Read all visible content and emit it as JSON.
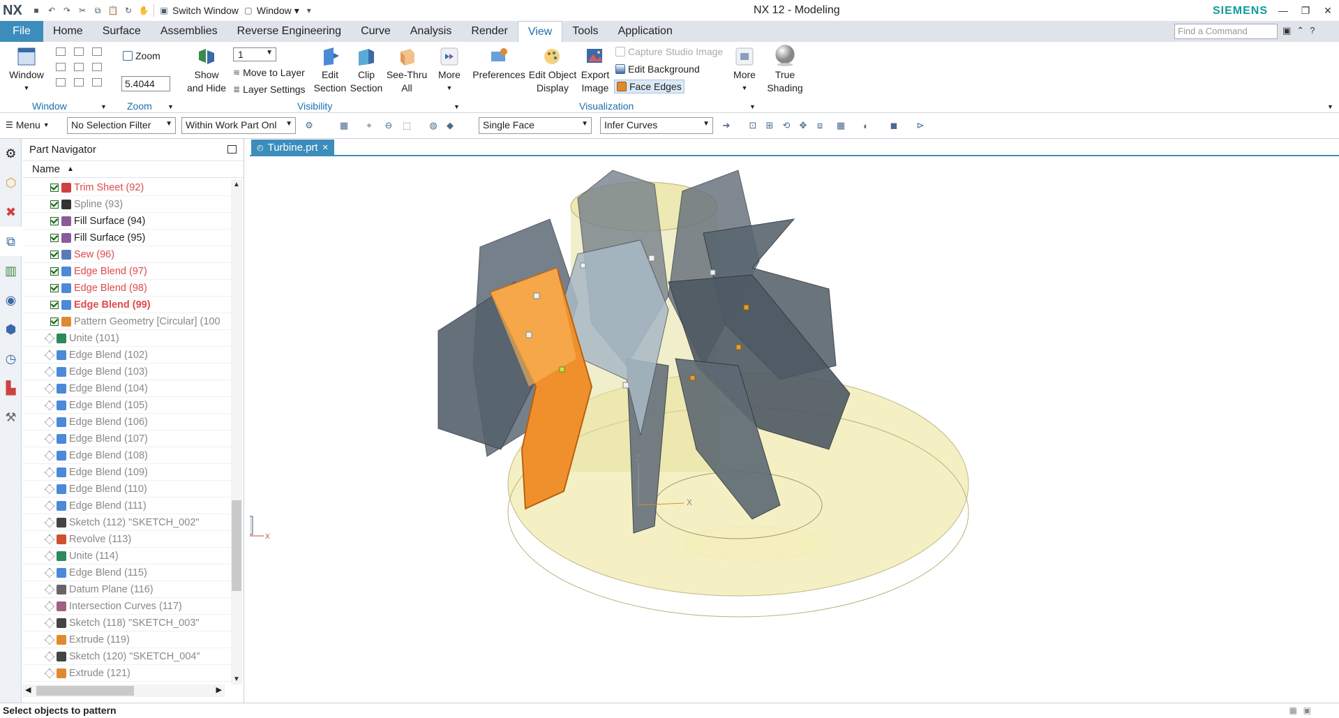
{
  "app": {
    "logo": "NX",
    "title": "NX 12 - Modeling",
    "brand": "SIEMENS"
  },
  "quick_access": {
    "switch_window": "Switch Window",
    "window": "Window"
  },
  "menu": {
    "file": "File",
    "tabs": [
      "Home",
      "Surface",
      "Assemblies",
      "Reverse Engineering",
      "Curve",
      "Analysis",
      "Render",
      "View",
      "Tools",
      "Application"
    ],
    "active_tab": "View",
    "find_placeholder": "Find a Command"
  },
  "ribbon": {
    "window_btn": "Window",
    "window_group": "Window",
    "zoom_btn": "Zoom",
    "zoom_value": "5.4044",
    "zoom_group": "Zoom",
    "layer_value": "1",
    "show_hide_1": "Show",
    "show_hide_2": "and Hide",
    "move_to_layer": "Move to Layer",
    "layer_settings": "Layer Settings",
    "edit_section_1": "Edit",
    "edit_section_2": "Section",
    "clip_section_1": "Clip",
    "clip_section_2": "Section",
    "see_thru_1": "See-Thru",
    "see_thru_2": "All",
    "more": "More",
    "visibility_group": "Visibility",
    "preferences": "Preferences",
    "edit_object_1": "Edit Object",
    "edit_object_2": "Display",
    "export_image_1": "Export",
    "export_image_2": "Image",
    "capture_studio": "Capture Studio Image",
    "edit_background": "Edit Background",
    "face_edges": "Face Edges",
    "visualization_group": "Visualization",
    "more2": "More",
    "true_shading_1": "True",
    "true_shading_2": "Shading"
  },
  "selection_bar": {
    "menu": "Menu",
    "filter": "No Selection Filter",
    "scope": "Within Work Part Onl",
    "face_rule": "Single Face",
    "curve_rule": "Infer Curves"
  },
  "navigator": {
    "title": "Part Navigator",
    "column": "Name",
    "items": [
      {
        "label": "Trim Sheet (92)",
        "style": "red",
        "checked": true,
        "icon": "trim-sheet-icon",
        "color": "#d04040"
      },
      {
        "label": "Spline (93)",
        "style": "gray",
        "checked": true,
        "icon": "spline-icon",
        "color": "#333333"
      },
      {
        "label": "Fill Surface (94)",
        "style": "dark",
        "checked": true,
        "icon": "fill-surface-icon",
        "color": "#8a5a9a"
      },
      {
        "label": "Fill Surface (95)",
        "style": "dark",
        "checked": true,
        "icon": "fill-surface-icon",
        "color": "#8a5a9a"
      },
      {
        "label": "Sew (96)",
        "style": "red",
        "checked": true,
        "icon": "sew-icon",
        "color": "#5a7ab8"
      },
      {
        "label": "Edge Blend (97)",
        "style": "red",
        "checked": true,
        "icon": "edge-blend-icon",
        "color": "#4a8ad8"
      },
      {
        "label": "Edge Blend (98)",
        "style": "red",
        "checked": true,
        "icon": "edge-blend-icon",
        "color": "#4a8ad8"
      },
      {
        "label": "Edge Blend (99)",
        "style": "red bold",
        "checked": true,
        "icon": "edge-blend-icon",
        "color": "#4a8ad8"
      },
      {
        "label": "Pattern Geometry [Circular] (100",
        "style": "gray",
        "checked": true,
        "icon": "pattern-geometry-icon",
        "color": "#e08a30"
      },
      {
        "label": "Unite (101)",
        "style": "gray",
        "checked": false,
        "icon": "unite-icon",
        "color": "#2a8a5a"
      },
      {
        "label": "Edge Blend (102)",
        "style": "gray",
        "checked": false,
        "icon": "edge-blend-icon",
        "color": "#4a8ad8"
      },
      {
        "label": "Edge Blend (103)",
        "style": "gray",
        "checked": false,
        "icon": "edge-blend-icon",
        "color": "#4a8ad8"
      },
      {
        "label": "Edge Blend (104)",
        "style": "gray",
        "checked": false,
        "icon": "edge-blend-icon",
        "color": "#4a8ad8"
      },
      {
        "label": "Edge Blend (105)",
        "style": "gray",
        "checked": false,
        "icon": "edge-blend-icon",
        "color": "#4a8ad8"
      },
      {
        "label": "Edge Blend (106)",
        "style": "gray",
        "checked": false,
        "icon": "edge-blend-icon",
        "color": "#4a8ad8"
      },
      {
        "label": "Edge Blend (107)",
        "style": "gray",
        "checked": false,
        "icon": "edge-blend-icon",
        "color": "#4a8ad8"
      },
      {
        "label": "Edge Blend (108)",
        "style": "gray",
        "checked": false,
        "icon": "edge-blend-icon",
        "color": "#4a8ad8"
      },
      {
        "label": "Edge Blend (109)",
        "style": "gray",
        "checked": false,
        "icon": "edge-blend-icon",
        "color": "#4a8ad8"
      },
      {
        "label": "Edge Blend (110)",
        "style": "gray",
        "checked": false,
        "icon": "edge-blend-icon",
        "color": "#4a8ad8"
      },
      {
        "label": "Edge Blend (111)",
        "style": "gray",
        "checked": false,
        "icon": "edge-blend-icon",
        "color": "#4a8ad8"
      },
      {
        "label": "Sketch (112) \"SKETCH_002\"",
        "style": "gray",
        "checked": false,
        "icon": "sketch-icon",
        "color": "#444444"
      },
      {
        "label": "Revolve (113)",
        "style": "gray",
        "checked": false,
        "icon": "revolve-icon",
        "color": "#d05030"
      },
      {
        "label": "Unite (114)",
        "style": "gray",
        "checked": false,
        "icon": "unite-icon",
        "color": "#2a8a5a"
      },
      {
        "label": "Edge Blend (115)",
        "style": "gray",
        "checked": false,
        "icon": "edge-blend-icon",
        "color": "#4a8ad8"
      },
      {
        "label": "Datum Plane (116)",
        "style": "gray",
        "checked": false,
        "icon": "datum-plane-icon",
        "color": "#666666"
      },
      {
        "label": "Intersection Curves (117)",
        "style": "gray",
        "checked": false,
        "icon": "intersection-curves-icon",
        "color": "#a06080"
      },
      {
        "label": "Sketch (118) \"SKETCH_003\"",
        "style": "gray",
        "checked": false,
        "icon": "sketch-icon",
        "color": "#444444"
      },
      {
        "label": "Extrude (119)",
        "style": "gray",
        "checked": false,
        "icon": "extrude-icon",
        "color": "#e08a30"
      },
      {
        "label": "Sketch (120) \"SKETCH_004\"",
        "style": "gray",
        "checked": false,
        "icon": "sketch-icon",
        "color": "#444444"
      },
      {
        "label": "Extrude (121)",
        "style": "gray",
        "checked": false,
        "icon": "extrude-icon",
        "color": "#e08a30"
      }
    ]
  },
  "viewport": {
    "tab_label": "Turbine.prt",
    "axis_x": "X",
    "axis_z": "Z"
  },
  "status": {
    "message": "Select objects to pattern"
  },
  "colors": {
    "accent": "#3c8dbc",
    "blade": "#5f6b76",
    "orange": "#f0902c",
    "hub": "#f3edb0"
  }
}
